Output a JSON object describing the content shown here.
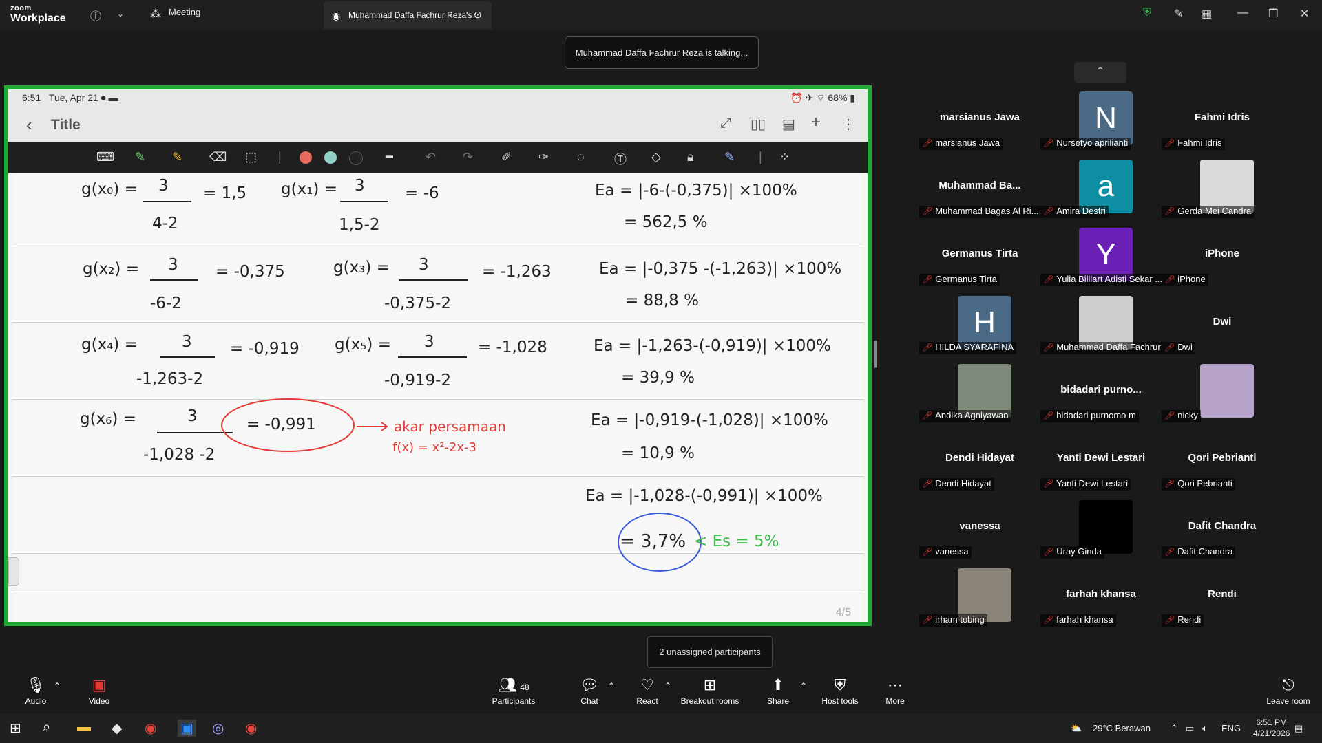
{
  "app": {
    "brand_top": "zoom",
    "brand_bottom": "Workplace",
    "meeting_tab": "Meeting",
    "share_tab": "Muhammad Daffa Fachrur Reza's"
  },
  "talking": "Muhammad Daffa Fachrur Reza is talking...",
  "ipad": {
    "time": "6:51",
    "date": "Tue, Apr 21",
    "battery": "68%",
    "note_title": "Title",
    "page_indicator": "4/5"
  },
  "math": {
    "r1": {
      "a": "g(x₀) =",
      "an": "3",
      "ad": "4-2",
      "ar": "= 1,5",
      "b": "g(x₁) =",
      "bn": "3",
      "bd": "1,5-2",
      "br": "= -6",
      "c": "Ea = |-6-(-0,375)| ×100%",
      "cr": "= 562,5 %"
    },
    "r2": {
      "a": "g(x₂) =",
      "an": "3",
      "ad": "-6-2",
      "ar": "= -0,375",
      "b": "g(x₃) =",
      "bn": "3",
      "bd": "-0,375-2",
      "br": "= -1,263",
      "c": "Ea = |-0,375 -(-1,263)| ×100%",
      "cr": "= 88,8 %"
    },
    "r3": {
      "a": "g(x₄) =",
      "an": "3",
      "ad": "-1,263-2",
      "ar": "= -0,919",
      "b": "g(x₅) =",
      "bn": "3",
      "bd": "-0,919-2",
      "br": "= -1,028",
      "c": "Ea = |-1,263-(-0,919)| ×100%",
      "cr": "= 39,9 %"
    },
    "r4": {
      "a": "g(x₆) =",
      "an": "3",
      "ad": "-1,028 -2",
      "ar": "= -0,991",
      "note": "akar persamaan",
      "fx": "f(x) = x²-2x-3",
      "c": "Ea = |-0,919-(-1,028)| ×100%",
      "cr": "= 10,9 %"
    },
    "r5": {
      "c": "Ea = |-1,028-(-0,991)| ×100%",
      "cr": "= 3,7%",
      "es": "< Es = 5%"
    }
  },
  "participants": [
    {
      "display": "marsianus Jawa",
      "label": "marsianus Jawa",
      "kind": "name"
    },
    {
      "display": "N",
      "label": "Nursetyo aprilianti",
      "kind": "letter",
      "color": "#4a6a85"
    },
    {
      "display": "Fahmi Idris",
      "label": "Fahmi Idris",
      "kind": "name"
    },
    {
      "display": "Muhammad  Ba...",
      "label": "Muhammad Bagas Al Ri...",
      "kind": "name"
    },
    {
      "display": "a",
      "label": "Amira Destri",
      "kind": "letter",
      "color": "#0d8ea3"
    },
    {
      "display": "",
      "label": "Gerda Mei Candra",
      "kind": "photo",
      "color": "#d9d9d9"
    },
    {
      "display": "Germanus Tirta",
      "label": "Germanus Tirta",
      "kind": "name"
    },
    {
      "display": "Y",
      "label": "Yulia Billiart Adisti Sekar ...",
      "kind": "letter",
      "color": "#6a1fb5"
    },
    {
      "display": "iPhone",
      "label": "iPhone",
      "kind": "name"
    },
    {
      "display": "H",
      "label": "HILDA SYARAFINA",
      "kind": "letter",
      "color": "#4a6a85"
    },
    {
      "display": "",
      "label": "Muhammad Daffa Fachrur ...",
      "kind": "photo",
      "color": "#cfcfcf"
    },
    {
      "display": "Dwi",
      "label": "Dwi",
      "kind": "name"
    },
    {
      "display": "",
      "label": "Andika Agniyawan",
      "kind": "photo",
      "color": "#7d8a7a"
    },
    {
      "display": "bidadari  purno...",
      "label": "bidadari purnomo m",
      "kind": "name"
    },
    {
      "display": "",
      "label": "nicky",
      "kind": "photo",
      "color": "#b7a3c9"
    },
    {
      "display": "Dendi Hidayat",
      "label": "Dendi Hidayat",
      "kind": "name"
    },
    {
      "display": "Yanti Dewi Lestari",
      "label": "Yanti Dewi Lestari",
      "kind": "name"
    },
    {
      "display": "Qori Pebrianti",
      "label": "Qori Pebrianti",
      "kind": "name"
    },
    {
      "display": "vanessa",
      "label": "vanessa",
      "kind": "name"
    },
    {
      "display": "",
      "label": "Uray Ginda",
      "kind": "photo",
      "color": "#000000"
    },
    {
      "display": "Dafit Chandra",
      "label": "Dafit Chandra",
      "kind": "name"
    },
    {
      "display": "",
      "label": "irham tobing",
      "kind": "photo",
      "color": "#8a8378"
    },
    {
      "display": "farhah khansa",
      "label": "farhah khansa",
      "kind": "name"
    },
    {
      "display": "Rendi",
      "label": "Rendi",
      "kind": "name"
    }
  ],
  "unassigned": "2 unassigned participants",
  "controls": {
    "audio": "Audio",
    "video": "Video",
    "participants": "Participants",
    "participants_count": "48",
    "chat": "Chat",
    "react": "React",
    "breakout": "Breakout rooms",
    "share": "Share",
    "host": "Host tools",
    "more": "More",
    "leave": "Leave room"
  },
  "taskbar": {
    "weather": "29°C  Berawan",
    "lang": "ENG",
    "time": "6:51 PM",
    "date": "4/21/2026"
  }
}
